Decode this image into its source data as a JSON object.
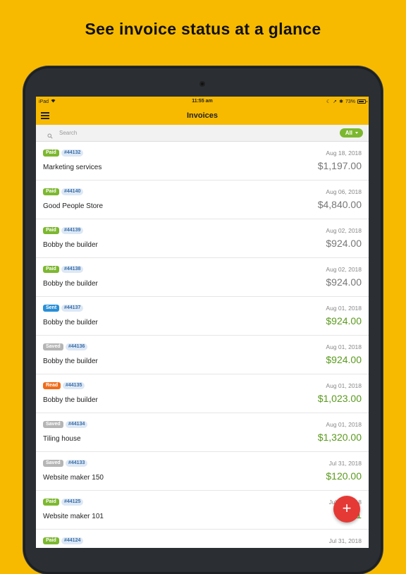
{
  "headline": "See invoice status at a glance",
  "status_bar": {
    "device": "iPad",
    "time": "11:55 am",
    "battery": "73%"
  },
  "nav": {
    "title": "Invoices",
    "menu_icon": "hamburger-menu-icon"
  },
  "search": {
    "placeholder": "Search",
    "filter_label": "All"
  },
  "colors": {
    "brand": "#F7BA00",
    "paid": "#7cb82f",
    "sent": "#2a8fd6",
    "saved": "#b5b5b5",
    "read": "#ef6c1a",
    "fab": "#e53935"
  },
  "invoices": [
    {
      "status": "Paid",
      "status_color": "#7cb82f",
      "number": "#44132",
      "client": "Marketing services",
      "date": "Aug 18, 2018",
      "amount": "$1,197.00",
      "amount_style": "gray"
    },
    {
      "status": "Paid",
      "status_color": "#7cb82f",
      "number": "#44140",
      "client": "Good People Store",
      "date": "Aug 06, 2018",
      "amount": "$4,840.00",
      "amount_style": "gray"
    },
    {
      "status": "Paid",
      "status_color": "#7cb82f",
      "number": "#44139",
      "client": "Bobby the builder",
      "date": "Aug 02, 2018",
      "amount": "$924.00",
      "amount_style": "gray"
    },
    {
      "status": "Paid",
      "status_color": "#7cb82f",
      "number": "#44138",
      "client": "Bobby the builder",
      "date": "Aug 02, 2018",
      "amount": "$924.00",
      "amount_style": "gray"
    },
    {
      "status": "Sent",
      "status_color": "#2a8fd6",
      "number": "#44137",
      "client": "Bobby the builder",
      "date": "Aug 01, 2018",
      "amount": "$924.00",
      "amount_style": "green"
    },
    {
      "status": "Saved",
      "status_color": "#b5b5b5",
      "number": "#44136",
      "client": "Bobby the builder",
      "date": "Aug 01, 2018",
      "amount": "$924.00",
      "amount_style": "green"
    },
    {
      "status": "Read",
      "status_color": "#ef6c1a",
      "number": "#44135",
      "client": "Bobby the builder",
      "date": "Aug 01, 2018",
      "amount": "$1,023.00",
      "amount_style": "green"
    },
    {
      "status": "Saved",
      "status_color": "#b5b5b5",
      "number": "#44134",
      "client": "Tiling house",
      "date": "Aug 01, 2018",
      "amount": "$1,320.00",
      "amount_style": "green"
    },
    {
      "status": "Saved",
      "status_color": "#b5b5b5",
      "number": "#44133",
      "client": "Website maker 150",
      "date": "Jul 31, 2018",
      "amount": "$120.00",
      "amount_style": "green"
    },
    {
      "status": "Paid",
      "status_color": "#7cb82f",
      "number": "#44125",
      "client": "Website maker 101",
      "date": "Jul 31, 2018",
      "amount": "$1",
      "amount_style": "green"
    },
    {
      "status": "Paid",
      "status_color": "#7cb82f",
      "number": "#44124",
      "client": "",
      "date": "Jul 31, 2018",
      "amount": "",
      "amount_style": "green"
    }
  ],
  "fab": {
    "label": "+",
    "icon": "plus-icon"
  }
}
